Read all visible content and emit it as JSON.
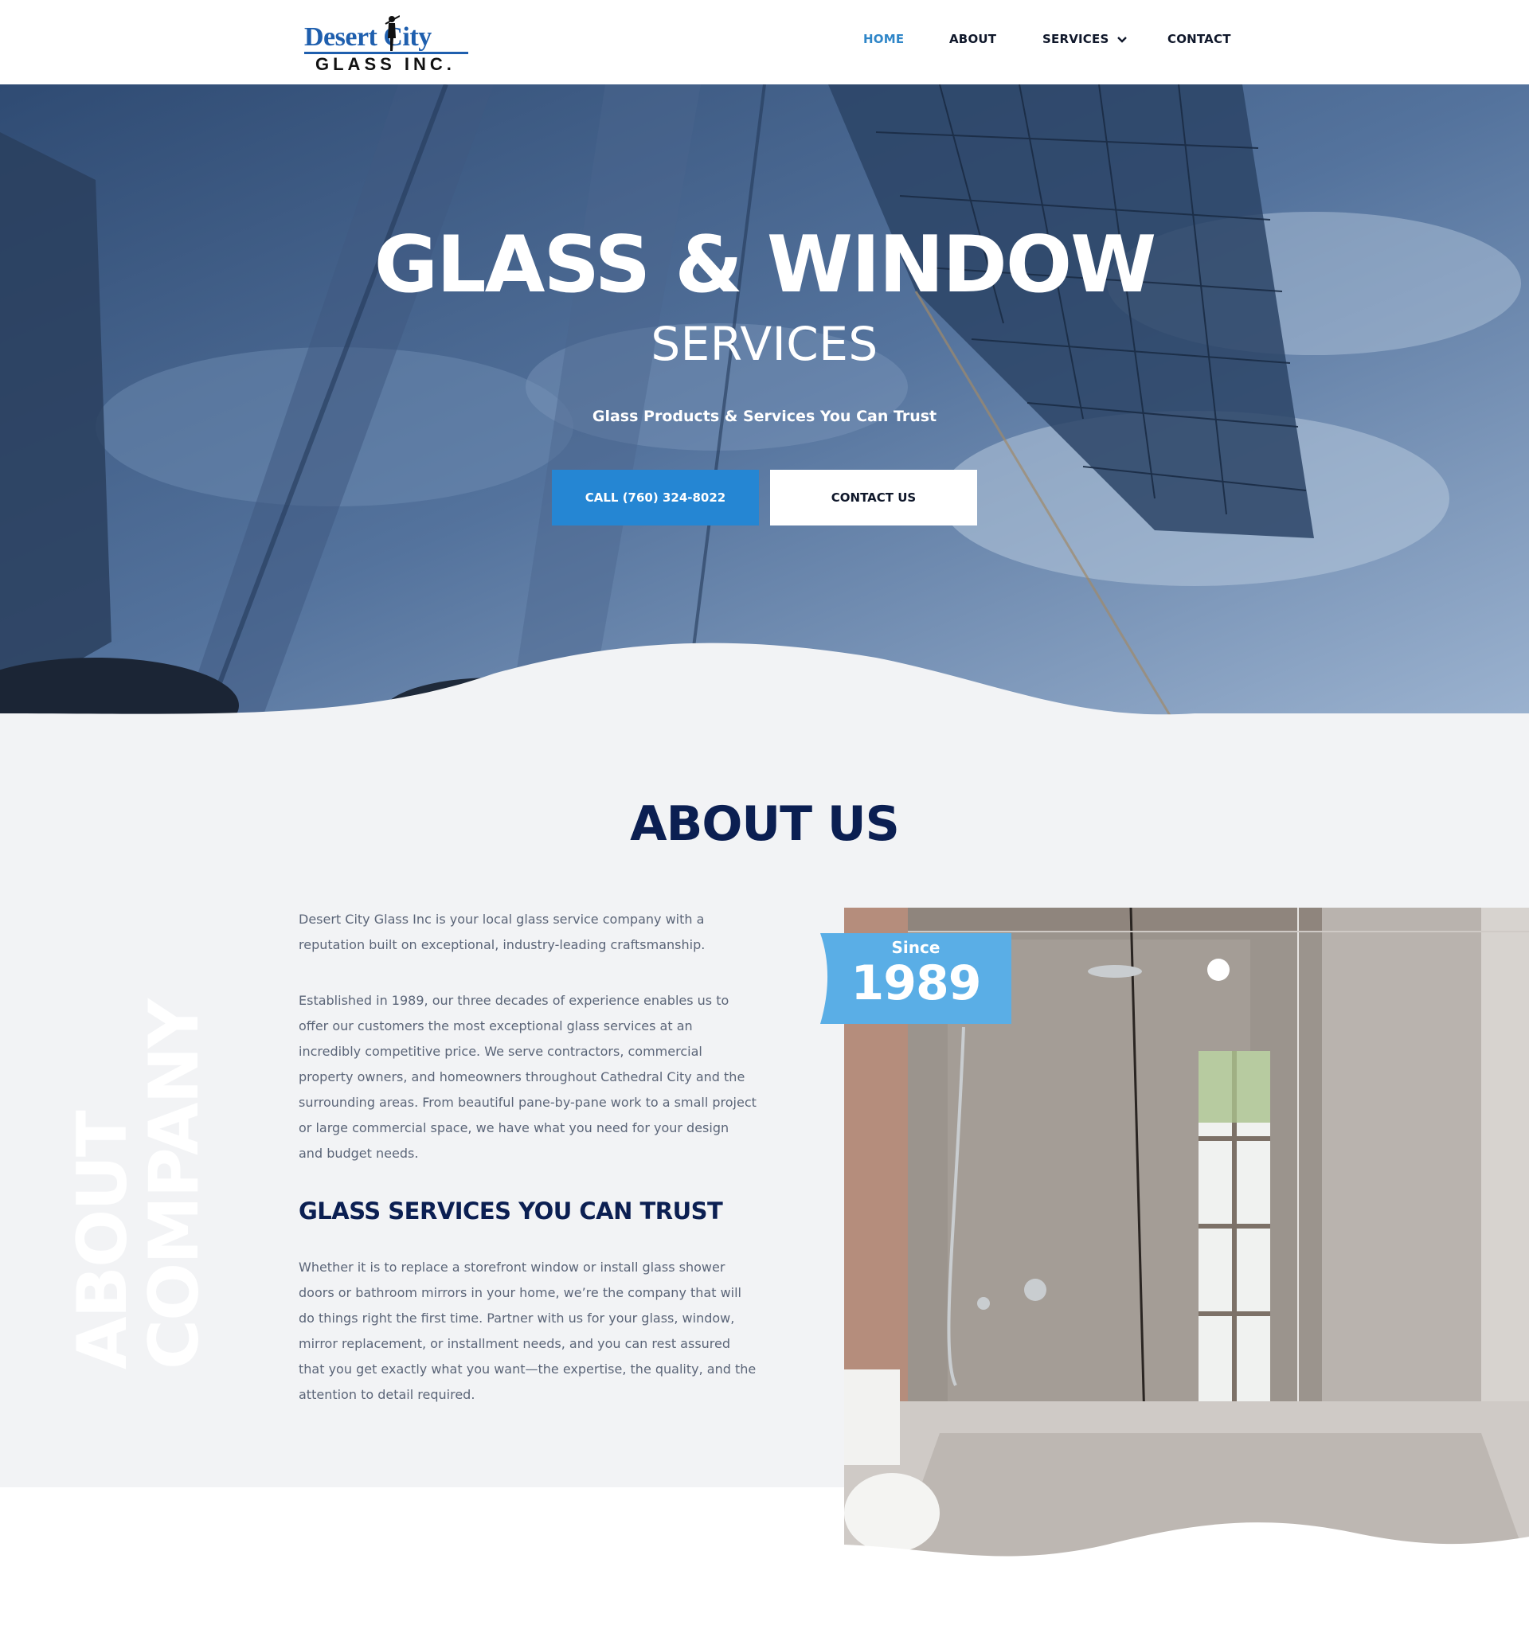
{
  "header": {
    "logo": {
      "line1": "Desert City",
      "line2": "GLASS INC."
    },
    "nav": [
      {
        "label": "HOME",
        "active": true
      },
      {
        "label": "ABOUT",
        "active": false
      },
      {
        "label": "SERVICES",
        "active": false,
        "icon": "chevron-down-icon"
      },
      {
        "label": "CONTACT",
        "active": false
      }
    ]
  },
  "hero": {
    "title": "GLASS & WINDOW",
    "subtitle": "SERVICES",
    "tagline": "Glass Products & Services You Can Trust",
    "call_button": "CALL (760) 324-8022",
    "contact_button": "CONTACT US"
  },
  "about": {
    "title": "ABOUT US",
    "vertical_line1": "ABOUT",
    "vertical_line2": "COMPANY",
    "paragraph1": "Desert City Glass Inc is your local glass service company with a reputation built on exceptional, industry-leading craftsmanship.",
    "paragraph2": "Established in 1989, our three decades of experience enables us to offer our customers the most exceptional glass services at an incredibly competitive price. We serve contractors, commercial property owners, and homeowners throughout Cathedral City and the surrounding areas. From beautiful pane-by-pane work to a small project or large commercial space, we have what you need for your design and budget needs.",
    "subheading": "GLASS SERVICES YOU CAN TRUST",
    "paragraph3": "Whether it is to replace a storefront window or install glass shower doors or bathroom mirrors in your home, we’re the company that will do things right the first time. Partner with us for your glass, window, mirror replacement, or installment needs, and you can rest assured that you get exactly what you want—the expertise, the quality, and the attention to detail required.",
    "badge_label": "Since",
    "badge_year": "1989"
  },
  "colors": {
    "accent": "#2586d3",
    "navy": "#0b1f52",
    "badge": "#5aaee6",
    "section_bg": "#f2f3f5"
  }
}
